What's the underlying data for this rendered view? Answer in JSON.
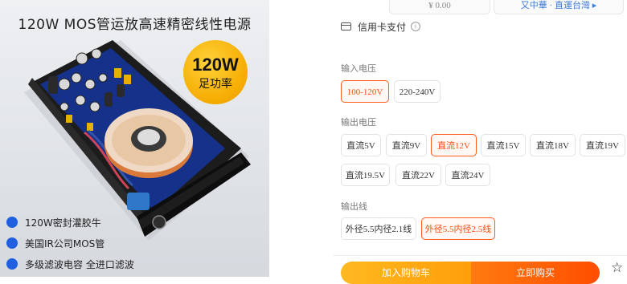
{
  "image": {
    "title": "120W  MOS管运放高速精密线性电源",
    "badge_big": "120W",
    "badge_small": "足功率",
    "features": [
      "120W密封灌胶牛",
      "美国IR公司MOS管",
      "多级滤波电容 全进口滤波"
    ]
  },
  "top": {
    "price_fragment": "¥ 0.00",
    "link_fragment": "又中華 · 直運台灣 ▸"
  },
  "payment": {
    "label": "信用卡支付",
    "info_icon": "i"
  },
  "input_voltage": {
    "label": "输入电压",
    "options": [
      "100-120V",
      "220-240V"
    ],
    "selected": "100-120V"
  },
  "output_voltage": {
    "label": "输出电压",
    "options": [
      "直流5V",
      "直流9V",
      "直流12V",
      "直流15V",
      "直流18V",
      "直流19V",
      "直流19.5V",
      "直流22V",
      "直流24V"
    ],
    "selected": "直流12V"
  },
  "output_cable": {
    "label": "输出线",
    "options": [
      "外径5.5内径2.1线",
      "外径5.5内径2.5线"
    ],
    "selected": "外径5.5内径2.5线"
  },
  "actions": {
    "add_to_cart": "加入购物车",
    "buy_now": "立即购买",
    "favorite_icon": "star-icon"
  },
  "colors": {
    "accent": "#ff5b1f",
    "feature_dot": "#1f5fe0",
    "badge": "#f5ab00"
  }
}
